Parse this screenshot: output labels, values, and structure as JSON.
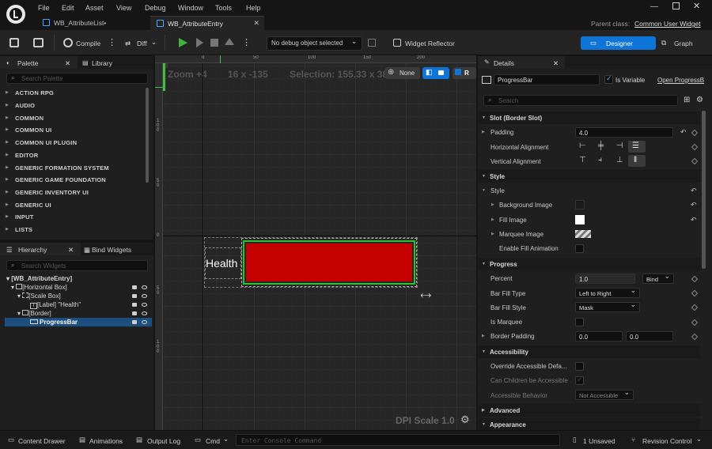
{
  "menu": [
    "File",
    "Edit",
    "Asset",
    "View",
    "Debug",
    "Window",
    "Tools",
    "Help"
  ],
  "tabs": [
    {
      "label": "WB_AttributeList•"
    },
    {
      "label": "WB_AttributeEntry"
    }
  ],
  "parent_class": {
    "label": "Parent class:",
    "value": "Common User Widget"
  },
  "toolbar": {
    "compile": "Compile",
    "diff": "Diff",
    "debug_object": "No debug object selected",
    "widget_reflector": "Widget Reflector",
    "designer": "Designer",
    "graph": "Graph"
  },
  "palette": {
    "tab_palette": "Palette",
    "tab_library": "Library",
    "search_placeholder": "Search Palette",
    "categories": [
      "ACTION RPG",
      "AUDIO",
      "COMMON",
      "COMMON UI",
      "COMMON UI PLUGIN",
      "EDITOR",
      "GENERIC FORMATION SYSTEM",
      "GENERIC GAME FOUNDATION",
      "GENERIC INVENTORY UI",
      "GENERIC UI",
      "INPUT",
      "LISTS"
    ]
  },
  "hierarchy": {
    "tab_hierarchy": "Hierarchy",
    "tab_bind": "Bind Widgets",
    "search_placeholder": "Search Widgets",
    "items": [
      {
        "label": "[WB_AttributeEntry]"
      },
      {
        "label": "[Horizontal Box]"
      },
      {
        "label": "[Scale Box]"
      },
      {
        "label": "[Label] \"Health\""
      },
      {
        "label": "[Border]"
      },
      {
        "label": "ProgressBar"
      }
    ]
  },
  "designer": {
    "zoom": "Zoom +4",
    "cursor": "16 x -135",
    "selection": "Selection: 155.33 x 38",
    "none_btn": "None",
    "r_btn": "R",
    "dpi": "DPI Scale 1.0",
    "label_text": "Health",
    "ruler_top": [
      "0",
      "50",
      "100",
      "150",
      "200"
    ],
    "ruler_left": [
      "1\n0\n0",
      "5\n0",
      "0",
      "5\n0",
      "1\n0\n0"
    ],
    "bar_color": "#c40000",
    "bar_border": "#2bbf2b"
  },
  "details": {
    "tab": "Details",
    "widget_name": "ProgressBar",
    "is_variable": "Is Variable",
    "open_link": "Open ProgressB",
    "search_placeholder": "Search",
    "sections": {
      "slot": "Slot (Border Slot)",
      "style": "Style",
      "progress": "Progress",
      "accessibility": "Accessibility",
      "advanced": "Advanced",
      "appearance": "Appearance"
    },
    "rows": {
      "padding": {
        "label": "Padding",
        "value": "4.0"
      },
      "halign": {
        "label": "Horizontal Alignment"
      },
      "valign": {
        "label": "Vertical Alignment"
      },
      "style": {
        "label": "Style"
      },
      "bg_image": {
        "label": "Background Image"
      },
      "fill_image": {
        "label": "Fill Image"
      },
      "marquee_image": {
        "label": "Marquee Image"
      },
      "fill_anim": {
        "label": "Enable Fill Animation"
      },
      "percent": {
        "label": "Percent",
        "value": "1.0",
        "bind": "Bind"
      },
      "bar_fill_type": {
        "label": "Bar Fill Type",
        "value": "Left to Right"
      },
      "bar_fill_style": {
        "label": "Bar Fill Style",
        "value": "Mask"
      },
      "is_marquee": {
        "label": "Is Marquee"
      },
      "border_padding": {
        "label": "Border Padding",
        "x": "0.0",
        "y": "0.0"
      },
      "override_access": {
        "label": "Override Accessible Defa..."
      },
      "can_children": {
        "label": "Can Children be Accessible"
      },
      "access_behavior": {
        "label": "Accessible Behavior",
        "value": "Not Accessible"
      }
    }
  },
  "statusbar": {
    "content_drawer": "Content Drawer",
    "animations": "Animations",
    "output_log": "Output Log",
    "cmd": "Cmd",
    "console_placeholder": "Enter Console Command",
    "unsaved": "1 Unsaved",
    "revision": "Revision Control"
  },
  "colors": {
    "accent": "#0e74d8",
    "play": "#3fb43f",
    "fill_white": "#ffffff"
  }
}
